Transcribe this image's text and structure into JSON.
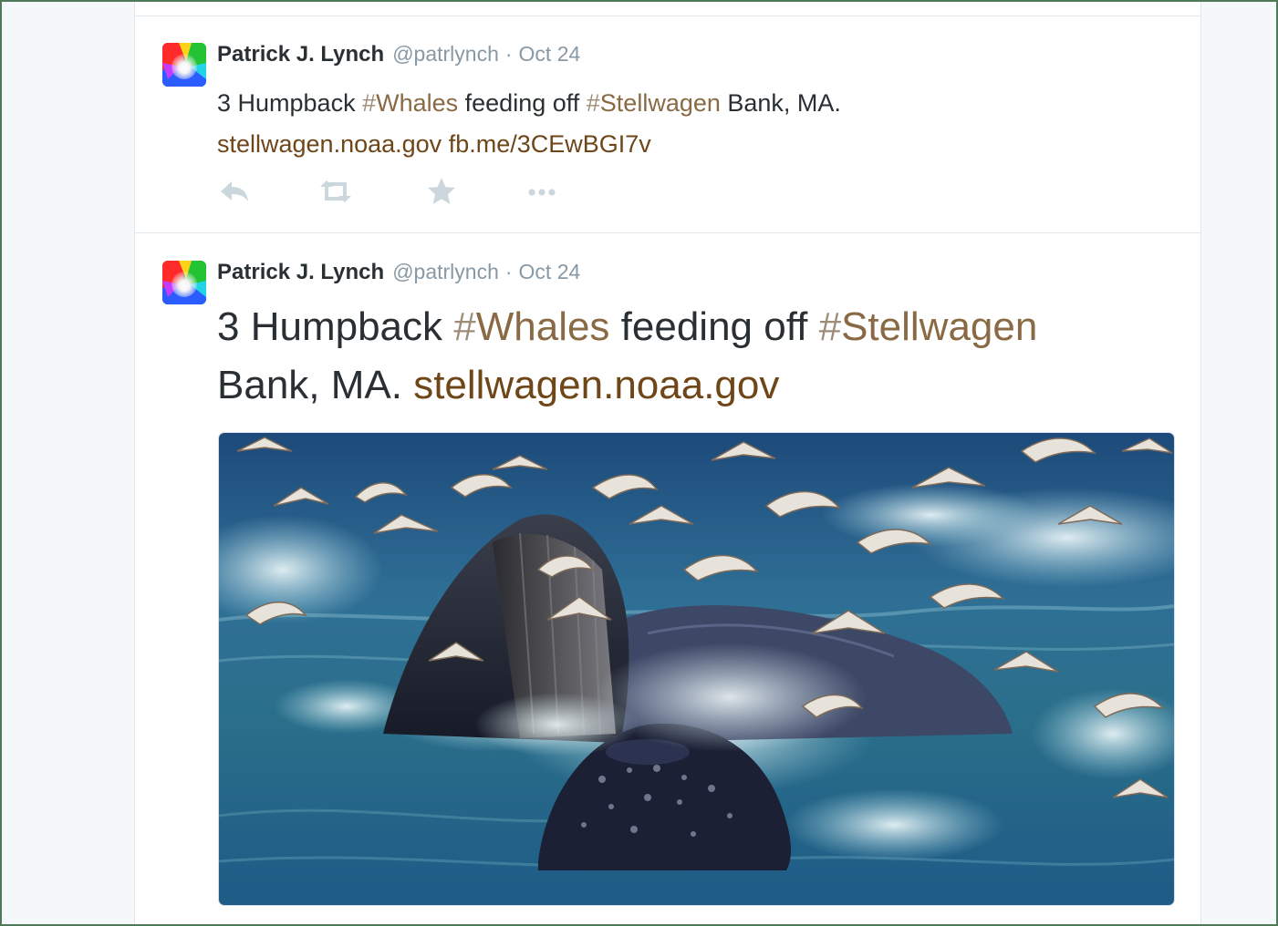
{
  "tweets": [
    {
      "author": {
        "name": "Patrick J. Lynch",
        "handle": "@patrlynch"
      },
      "separator": "·",
      "time": "Oct 24",
      "text": {
        "t1": "3 Humpback ",
        "hash1_sym": "#",
        "hash1_word": "Whales",
        "t2": " feeding off ",
        "hash2_sym": "#",
        "hash2_word": "Stellwagen",
        "t3": " Bank, MA.",
        "link1": "stellwagen.noaa.gov",
        "link2": "fb.me/3CEwBGI7v"
      },
      "actions": [
        "reply-icon",
        "retweet-icon",
        "favorite-icon",
        "more-icon"
      ]
    },
    {
      "author": {
        "name": "Patrick J. Lynch",
        "handle": "@patrlynch"
      },
      "separator": "·",
      "time": "Oct 24",
      "text": {
        "t1": "3 Humpback ",
        "hash1_sym": "#",
        "hash1_word": "Whales",
        "t2": " feeding off ",
        "hash2_sym": "#",
        "hash2_word": "Stellwagen",
        "t3": "Bank, MA. ",
        "link1": "stellwagen.noaa.gov"
      },
      "media": "whales-gulls-photo"
    }
  ],
  "colors": {
    "text": "#292f33",
    "meta": "#8899a6",
    "hashtag": "#8a6a44",
    "link": "#6e4618",
    "action": "#ccd6dd",
    "border": "#e1e8ed",
    "frame": "#4f7a57"
  }
}
